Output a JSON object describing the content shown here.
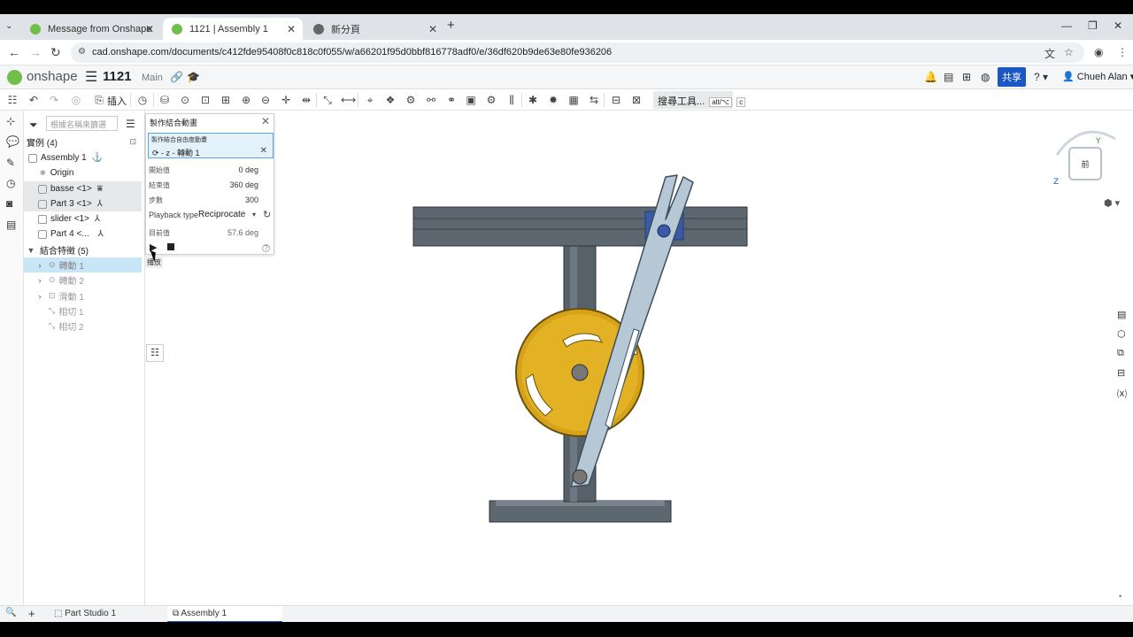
{
  "browser": {
    "tabs": [
      {
        "title": "Message from Onshape",
        "color": "#6fbf4a"
      },
      {
        "title": "1121 | Assembly 1",
        "color": "#6fbf4a"
      },
      {
        "title": "新分頁",
        "color": "#666"
      }
    ],
    "url": "cad.onshape.com/documents/c412fde95408f0c818c0f055/w/a66201f95d0bbf816778adf0/e/36df620b9de63e80fe936206",
    "new_tab": "+",
    "win_min": "—",
    "win_max": "❐",
    "win_close": "✕"
  },
  "header": {
    "logo": "onshape",
    "doc_name": "1121",
    "branch": "Main",
    "share_label": "共享",
    "user_name": "Chueh Alan",
    "accent": "#1a56c4"
  },
  "toolbar": {
    "insert_label": "插入",
    "search_tools_label": "搜尋工具...",
    "shortcut_key1": "alt/⌥",
    "shortcut_key2": "c"
  },
  "tree": {
    "search_placeholder": "根據名稱來篩選",
    "instances_header": "實例 (4)",
    "items": [
      {
        "label": "Assembly 1"
      },
      {
        "label": "Origin"
      },
      {
        "label": "basse <1>"
      },
      {
        "label": "Part 3 <1>"
      },
      {
        "label": "slider <1>"
      },
      {
        "label": "Part 4 <..."
      }
    ],
    "mate_header": "結合特徵 (5)",
    "mates": [
      {
        "label": "轉動 1"
      },
      {
        "label": "轉動 2"
      },
      {
        "label": "滑動 1"
      },
      {
        "label": "相切 1"
      },
      {
        "label": "相切 2"
      }
    ]
  },
  "dialog": {
    "title": "製作結合動畫",
    "sel_label": "製作結合自由度動畫",
    "sel_value": "⟳ - z - 轉動 1",
    "start_label": "開始值",
    "start_value": "0 deg",
    "end_label": "結束值",
    "end_value": "360 deg",
    "steps_label": "步數",
    "steps_value": "300",
    "playback_label": "Playback type",
    "playback_value": "Reciprocate",
    "current_label": "目前值",
    "current_value": "57.6 deg",
    "tooltip": "播放",
    "help": "?"
  },
  "viewcube": {
    "face_label": "前",
    "axis_y": "Y",
    "axis_z": "Z"
  },
  "bottom_tabs": [
    {
      "label": "Part Studio 1"
    },
    {
      "label": "Assembly 1"
    }
  ]
}
